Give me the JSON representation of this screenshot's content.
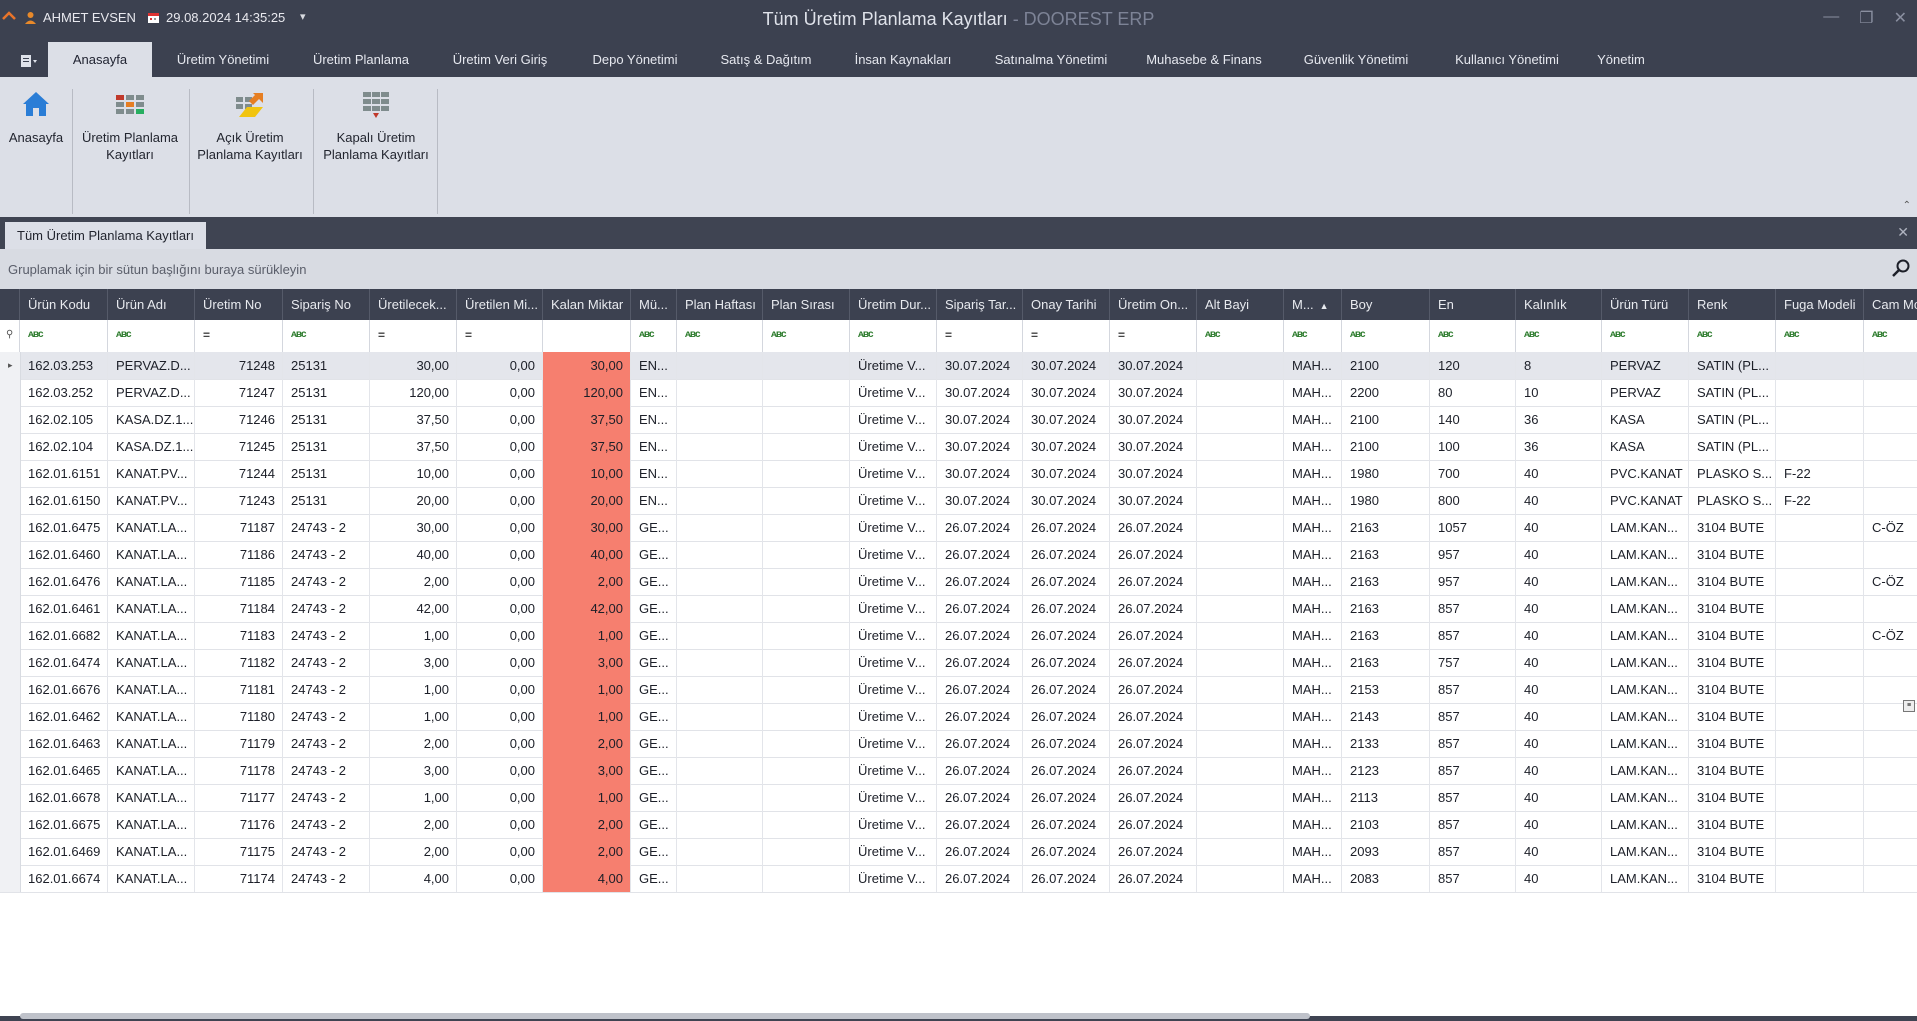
{
  "titlebar": {
    "user": "AHMET EVSEN",
    "datetime": "29.08.2024 14:35:25",
    "title": "Tüm Üretim Planlama Kayıtları",
    "app_name": " - DOOREST ERP"
  },
  "menu": {
    "tabs": [
      "Anasayfa",
      "Üretim Yönetimi",
      "Üretim Planlama",
      "Üretim Veri Giriş",
      "Depo Yönetimi",
      "Satış & Dağıtım",
      "İnsan Kaynakları",
      "Satınalma Yönetimi",
      "Muhasebe & Finans",
      "Güvenlik Yönetimi",
      "Kullanıcı Yönetimi",
      "Yönetim"
    ],
    "active": "Anasayfa"
  },
  "ribbon": {
    "home": "Anasayfa",
    "plan_line1": "Üretim Planlama",
    "plan_line2": "Kayıtları",
    "open_line1": "Açık Üretim",
    "open_line2": "Planlama Kayıtları",
    "closed_line1": "Kapalı Üretim",
    "closed_line2": "Planlama Kayıtları"
  },
  "doc_tab": "Tüm Üretim Planlama Kayıtları",
  "group_panel_text": "Gruplamak için bir sütun başlığını buraya sürükleyin",
  "columns": [
    "Ürün Kodu",
    "Ürün Adı",
    "Üretim No",
    "Sipariş No",
    "Üretilecek...",
    "Üretilen Mi...",
    "Kalan Miktar",
    "Mü...",
    "Plan Haftası",
    "Plan Sırası",
    "Üretim Dur...",
    "Sipariş Tar...",
    "Onay Tarihi",
    "Üretim On...",
    "Alt Bayi",
    "M...",
    "Boy",
    "En",
    "Kalınlık",
    "Ürün Türü",
    "Renk",
    "Fuga Modeli",
    "Cam Mo"
  ],
  "rows": [
    [
      "162.03.253",
      "PERVAZ.D...",
      "71248",
      "25131",
      "30,00",
      "0,00",
      "30,00",
      "EN...",
      "",
      "",
      "Üretime V...",
      "30.07.2024",
      "30.07.2024",
      "30.07.2024",
      "",
      "MAH...",
      "2100",
      "120",
      "8",
      "PERVAZ",
      "SATIN (PL...",
      "",
      ""
    ],
    [
      "162.03.252",
      "PERVAZ.D...",
      "71247",
      "25131",
      "120,00",
      "0,00",
      "120,00",
      "EN...",
      "",
      "",
      "Üretime V...",
      "30.07.2024",
      "30.07.2024",
      "30.07.2024",
      "",
      "MAH...",
      "2200",
      "80",
      "10",
      "PERVAZ",
      "SATIN (PL...",
      "",
      ""
    ],
    [
      "162.02.105",
      "KASA.DZ.1...",
      "71246",
      "25131",
      "37,50",
      "0,00",
      "37,50",
      "EN...",
      "",
      "",
      "Üretime V...",
      "30.07.2024",
      "30.07.2024",
      "30.07.2024",
      "",
      "MAH...",
      "2100",
      "140",
      "36",
      "KASA",
      "SATIN (PL...",
      "",
      ""
    ],
    [
      "162.02.104",
      "KASA.DZ.1...",
      "71245",
      "25131",
      "37,50",
      "0,00",
      "37,50",
      "EN...",
      "",
      "",
      "Üretime V...",
      "30.07.2024",
      "30.07.2024",
      "30.07.2024",
      "",
      "MAH...",
      "2100",
      "100",
      "36",
      "KASA",
      "SATIN (PL...",
      "",
      ""
    ],
    [
      "162.01.6151",
      "KANAT.PV...",
      "71244",
      "25131",
      "10,00",
      "0,00",
      "10,00",
      "EN...",
      "",
      "",
      "Üretime V...",
      "30.07.2024",
      "30.07.2024",
      "30.07.2024",
      "",
      "MAH...",
      "1980",
      "700",
      "40",
      "PVC.KANAT",
      "PLASKO S...",
      "F-22",
      ""
    ],
    [
      "162.01.6150",
      "KANAT.PV...",
      "71243",
      "25131",
      "20,00",
      "0,00",
      "20,00",
      "EN...",
      "",
      "",
      "Üretime V...",
      "30.07.2024",
      "30.07.2024",
      "30.07.2024",
      "",
      "MAH...",
      "1980",
      "800",
      "40",
      "PVC.KANAT",
      "PLASKO S...",
      "F-22",
      ""
    ],
    [
      "162.01.6475",
      "KANAT.LA...",
      "71187",
      "24743 - 2",
      "30,00",
      "0,00",
      "30,00",
      "GE...",
      "",
      "",
      "Üretime V...",
      "26.07.2024",
      "26.07.2024",
      "26.07.2024",
      "",
      "MAH...",
      "2163",
      "1057",
      "40",
      "LAM.KAN...",
      "3104 BUTE",
      "",
      "C-ÖZ"
    ],
    [
      "162.01.6460",
      "KANAT.LA...",
      "71186",
      "24743 - 2",
      "40,00",
      "0,00",
      "40,00",
      "GE...",
      "",
      "",
      "Üretime V...",
      "26.07.2024",
      "26.07.2024",
      "26.07.2024",
      "",
      "MAH...",
      "2163",
      "957",
      "40",
      "LAM.KAN...",
      "3104 BUTE",
      "",
      ""
    ],
    [
      "162.01.6476",
      "KANAT.LA...",
      "71185",
      "24743 - 2",
      "2,00",
      "0,00",
      "2,00",
      "GE...",
      "",
      "",
      "Üretime V...",
      "26.07.2024",
      "26.07.2024",
      "26.07.2024",
      "",
      "MAH...",
      "2163",
      "957",
      "40",
      "LAM.KAN...",
      "3104 BUTE",
      "",
      "C-ÖZ"
    ],
    [
      "162.01.6461",
      "KANAT.LA...",
      "71184",
      "24743 - 2",
      "42,00",
      "0,00",
      "42,00",
      "GE...",
      "",
      "",
      "Üretime V...",
      "26.07.2024",
      "26.07.2024",
      "26.07.2024",
      "",
      "MAH...",
      "2163",
      "857",
      "40",
      "LAM.KAN...",
      "3104 BUTE",
      "",
      ""
    ],
    [
      "162.01.6682",
      "KANAT.LA...",
      "71183",
      "24743 - 2",
      "1,00",
      "0,00",
      "1,00",
      "GE...",
      "",
      "",
      "Üretime V...",
      "26.07.2024",
      "26.07.2024",
      "26.07.2024",
      "",
      "MAH...",
      "2163",
      "857",
      "40",
      "LAM.KAN...",
      "3104 BUTE",
      "",
      "C-ÖZ"
    ],
    [
      "162.01.6474",
      "KANAT.LA...",
      "71182",
      "24743 - 2",
      "3,00",
      "0,00",
      "3,00",
      "GE...",
      "",
      "",
      "Üretime V...",
      "26.07.2024",
      "26.07.2024",
      "26.07.2024",
      "",
      "MAH...",
      "2163",
      "757",
      "40",
      "LAM.KAN...",
      "3104 BUTE",
      "",
      ""
    ],
    [
      "162.01.6676",
      "KANAT.LA...",
      "71181",
      "24743 - 2",
      "1,00",
      "0,00",
      "1,00",
      "GE...",
      "",
      "",
      "Üretime V...",
      "26.07.2024",
      "26.07.2024",
      "26.07.2024",
      "",
      "MAH...",
      "2153",
      "857",
      "40",
      "LAM.KAN...",
      "3104 BUTE",
      "",
      ""
    ],
    [
      "162.01.6462",
      "KANAT.LA...",
      "71180",
      "24743 - 2",
      "1,00",
      "0,00",
      "1,00",
      "GE...",
      "",
      "",
      "Üretime V...",
      "26.07.2024",
      "26.07.2024",
      "26.07.2024",
      "",
      "MAH...",
      "2143",
      "857",
      "40",
      "LAM.KAN...",
      "3104 BUTE",
      "",
      ""
    ],
    [
      "162.01.6463",
      "KANAT.LA...",
      "71179",
      "24743 - 2",
      "2,00",
      "0,00",
      "2,00",
      "GE...",
      "",
      "",
      "Üretime V...",
      "26.07.2024",
      "26.07.2024",
      "26.07.2024",
      "",
      "MAH...",
      "2133",
      "857",
      "40",
      "LAM.KAN...",
      "3104 BUTE",
      "",
      ""
    ],
    [
      "162.01.6465",
      "KANAT.LA...",
      "71178",
      "24743 - 2",
      "3,00",
      "0,00",
      "3,00",
      "GE...",
      "",
      "",
      "Üretime V...",
      "26.07.2024",
      "26.07.2024",
      "26.07.2024",
      "",
      "MAH...",
      "2123",
      "857",
      "40",
      "LAM.KAN...",
      "3104 BUTE",
      "",
      ""
    ],
    [
      "162.01.6678",
      "KANAT.LA...",
      "71177",
      "24743 - 2",
      "1,00",
      "0,00",
      "1,00",
      "GE...",
      "",
      "",
      "Üretime V...",
      "26.07.2024",
      "26.07.2024",
      "26.07.2024",
      "",
      "MAH...",
      "2113",
      "857",
      "40",
      "LAM.KAN...",
      "3104 BUTE",
      "",
      ""
    ],
    [
      "162.01.6675",
      "KANAT.LA...",
      "71176",
      "24743 - 2",
      "2,00",
      "0,00",
      "2,00",
      "GE...",
      "",
      "",
      "Üretime V...",
      "26.07.2024",
      "26.07.2024",
      "26.07.2024",
      "",
      "MAH...",
      "2103",
      "857",
      "40",
      "LAM.KAN...",
      "3104 BUTE",
      "",
      ""
    ],
    [
      "162.01.6469",
      "KANAT.LA...",
      "71175",
      "24743 - 2",
      "2,00",
      "0,00",
      "2,00",
      "GE...",
      "",
      "",
      "Üretime V...",
      "26.07.2024",
      "26.07.2024",
      "26.07.2024",
      "",
      "MAH...",
      "2093",
      "857",
      "40",
      "LAM.KAN...",
      "3104 BUTE",
      "",
      ""
    ],
    [
      "162.01.6674",
      "KANAT.LA...",
      "71174",
      "24743 - 2",
      "4,00",
      "0,00",
      "4,00",
      "GE...",
      "",
      "",
      "Üretime V...",
      "26.07.2024",
      "26.07.2024",
      "26.07.2024",
      "",
      "MAH...",
      "2083",
      "857",
      "40",
      "LAM.KAN...",
      "3104 BUTE",
      "",
      ""
    ]
  ],
  "colors": {
    "titlebar": "#3c4150",
    "ribbon": "#dcdfe7",
    "remaining_highlight": "#f67f6f",
    "selected_row": "#e4e6ec"
  }
}
